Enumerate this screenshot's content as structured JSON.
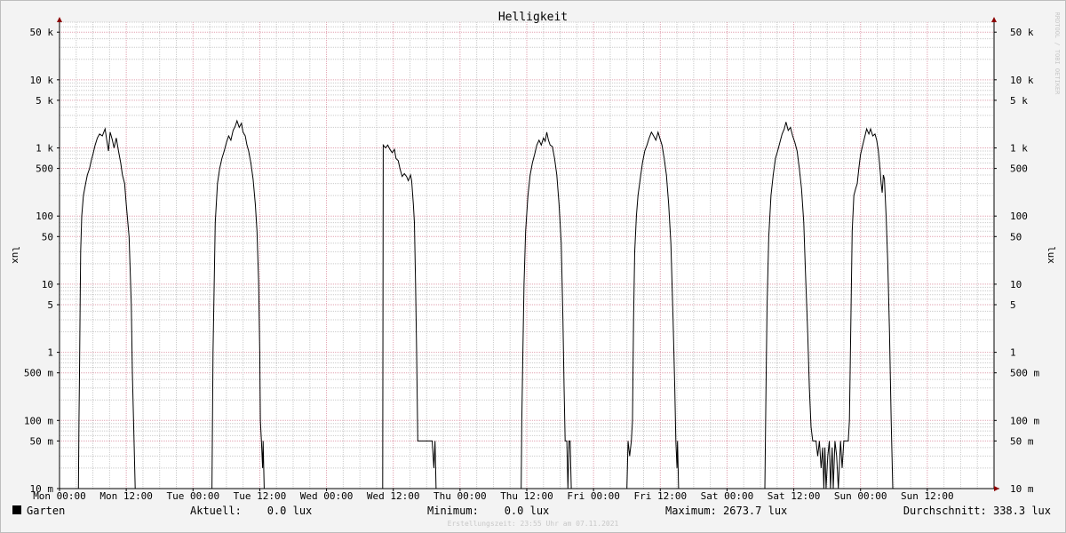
{
  "chart_data": {
    "type": "line",
    "title": "Helligkeit",
    "ylabel": "lux",
    "ylabel_right": "lux",
    "y_scale": "log",
    "ylim": [
      0.01,
      70000
    ],
    "y_ticks": [
      {
        "value": 0.01,
        "label": "10 m"
      },
      {
        "value": 0.05,
        "label": "50 m"
      },
      {
        "value": 0.1,
        "label": "100 m"
      },
      {
        "value": 0.5,
        "label": "500 m"
      },
      {
        "value": 1,
        "label": "1"
      },
      {
        "value": 5,
        "label": "5"
      },
      {
        "value": 10,
        "label": "10"
      },
      {
        "value": 50,
        "label": "50"
      },
      {
        "value": 100,
        "label": "100"
      },
      {
        "value": 500,
        "label": "500"
      },
      {
        "value": 1000,
        "label": "1 k"
      },
      {
        "value": 5000,
        "label": "5 k"
      },
      {
        "value": 10000,
        "label": "10 k"
      },
      {
        "value": 50000,
        "label": "50 k"
      }
    ],
    "x_unit": "hours",
    "xlim": [
      0,
      168
    ],
    "x_ticks": [
      {
        "value": 0,
        "label": "Mon 00:00"
      },
      {
        "value": 12,
        "label": "Mon 12:00"
      },
      {
        "value": 24,
        "label": "Tue 00:00"
      },
      {
        "value": 36,
        "label": "Tue 12:00"
      },
      {
        "value": 48,
        "label": "Wed 00:00"
      },
      {
        "value": 60,
        "label": "Wed 12:00"
      },
      {
        "value": 72,
        "label": "Thu 00:00"
      },
      {
        "value": 84,
        "label": "Thu 12:00"
      },
      {
        "value": 96,
        "label": "Fri 00:00"
      },
      {
        "value": 108,
        "label": "Fri 12:00"
      },
      {
        "value": 120,
        "label": "Sat 00:00"
      },
      {
        "value": 132,
        "label": "Sat 12:00"
      },
      {
        "value": 144,
        "label": "Sun 00:00"
      },
      {
        "value": 156,
        "label": "Sun 12:00"
      }
    ],
    "grid": true,
    "series": [
      {
        "name": "Garten",
        "color": "#000000",
        "points": [
          [
            0,
            0.01
          ],
          [
            3.4,
            0.01
          ],
          [
            3.5,
            0.1
          ],
          [
            3.6,
            0.5
          ],
          [
            3.7,
            5
          ],
          [
            3.8,
            30
          ],
          [
            4.0,
            100
          ],
          [
            4.3,
            200
          ],
          [
            4.7,
            300
          ],
          [
            5.0,
            400
          ],
          [
            5.4,
            500
          ],
          [
            5.7,
            650
          ],
          [
            6.0,
            800
          ],
          [
            6.4,
            1100
          ],
          [
            6.8,
            1400
          ],
          [
            7.2,
            1600
          ],
          [
            7.7,
            1500
          ],
          [
            8.2,
            1900
          ],
          [
            8.5,
            1300
          ],
          [
            8.8,
            900
          ],
          [
            9.1,
            1700
          ],
          [
            9.5,
            1300
          ],
          [
            9.8,
            1000
          ],
          [
            10.2,
            1400
          ],
          [
            10.6,
            900
          ],
          [
            11.0,
            600
          ],
          [
            11.3,
            400
          ],
          [
            11.7,
            300
          ],
          [
            12.0,
            150
          ],
          [
            12.5,
            50
          ],
          [
            12.9,
            5
          ],
          [
            13.1,
            0.5
          ],
          [
            13.4,
            0.05
          ],
          [
            13.6,
            0.01
          ],
          [
            15,
            0.01
          ],
          [
            15.5,
            0.01
          ],
          [
            27.4,
            0.01
          ],
          [
            27.5,
            0.1
          ],
          [
            27.6,
            1
          ],
          [
            27.8,
            10
          ],
          [
            28.0,
            80
          ],
          [
            28.4,
            300
          ],
          [
            28.8,
            500
          ],
          [
            29.2,
            700
          ],
          [
            29.6,
            900
          ],
          [
            30.0,
            1200
          ],
          [
            30.4,
            1500
          ],
          [
            30.8,
            1300
          ],
          [
            31.2,
            1800
          ],
          [
            31.6,
            2100
          ],
          [
            31.9,
            2500
          ],
          [
            32.3,
            2000
          ],
          [
            32.7,
            2300
          ],
          [
            33.0,
            1700
          ],
          [
            33.4,
            1500
          ],
          [
            33.7,
            1100
          ],
          [
            34.0,
            900
          ],
          [
            34.4,
            600
          ],
          [
            34.8,
            350
          ],
          [
            35.2,
            150
          ],
          [
            35.5,
            60
          ],
          [
            35.8,
            10
          ],
          [
            36.0,
            1
          ],
          [
            36.1,
            0.1
          ],
          [
            36.3,
            0.05
          ],
          [
            36.5,
            0.02
          ],
          [
            36.6,
            0.05
          ],
          [
            36.8,
            0.01
          ],
          [
            37.5,
            0.01
          ],
          [
            58.1,
            0.01
          ],
          [
            58.2,
            1100
          ],
          [
            58.6,
            1000
          ],
          [
            59.0,
            1100
          ],
          [
            59.4,
            950
          ],
          [
            59.8,
            850
          ],
          [
            60.2,
            950
          ],
          [
            60.5,
            700
          ],
          [
            60.9,
            650
          ],
          [
            61.2,
            500
          ],
          [
            61.6,
            380
          ],
          [
            62.0,
            420
          ],
          [
            62.4,
            380
          ],
          [
            62.7,
            330
          ],
          [
            63.1,
            400
          ],
          [
            63.3,
            330
          ],
          [
            63.6,
            150
          ],
          [
            63.8,
            80
          ],
          [
            64.0,
            10
          ],
          [
            64.2,
            1
          ],
          [
            64.4,
            0.05
          ],
          [
            67.0,
            0.05
          ],
          [
            67.3,
            0.02
          ],
          [
            67.5,
            0.05
          ],
          [
            67.7,
            0.01
          ],
          [
            68.5,
            0.01
          ],
          [
            83.0,
            0.01
          ],
          [
            83.1,
            0.1
          ],
          [
            83.3,
            1
          ],
          [
            83.5,
            10
          ],
          [
            83.8,
            60
          ],
          [
            84.2,
            200
          ],
          [
            84.6,
            400
          ],
          [
            85.0,
            600
          ],
          [
            85.4,
            800
          ],
          [
            85.8,
            1100
          ],
          [
            86.2,
            1300
          ],
          [
            86.6,
            1100
          ],
          [
            87.0,
            1400
          ],
          [
            87.3,
            1250
          ],
          [
            87.6,
            1700
          ],
          [
            87.9,
            1300
          ],
          [
            88.2,
            1100
          ],
          [
            88.6,
            1050
          ],
          [
            89.0,
            700
          ],
          [
            89.4,
            400
          ],
          [
            89.8,
            150
          ],
          [
            90.2,
            40
          ],
          [
            90.5,
            3
          ],
          [
            90.7,
            0.3
          ],
          [
            90.9,
            0.05
          ],
          [
            91.2,
            0.05
          ],
          [
            91.4,
            0.01
          ],
          [
            91.6,
            0.05
          ],
          [
            91.8,
            0.05
          ],
          [
            92.0,
            0.01
          ],
          [
            102.0,
            0.01
          ],
          [
            102.2,
            0.05
          ],
          [
            102.5,
            0.03
          ],
          [
            102.8,
            0.05
          ],
          [
            103.0,
            0.1
          ],
          [
            103.2,
            3
          ],
          [
            103.4,
            30
          ],
          [
            103.7,
            100
          ],
          [
            104.0,
            200
          ],
          [
            104.4,
            350
          ],
          [
            104.8,
            600
          ],
          [
            105.2,
            900
          ],
          [
            105.6,
            1100
          ],
          [
            106.0,
            1400
          ],
          [
            106.4,
            1700
          ],
          [
            106.8,
            1500
          ],
          [
            107.2,
            1300
          ],
          [
            107.6,
            1700
          ],
          [
            107.9,
            1400
          ],
          [
            108.3,
            1100
          ],
          [
            108.7,
            700
          ],
          [
            109.1,
            400
          ],
          [
            109.5,
            150
          ],
          [
            109.9,
            40
          ],
          [
            110.3,
            3
          ],
          [
            110.6,
            0.3
          ],
          [
            110.8,
            0.05
          ],
          [
            111.0,
            0.02
          ],
          [
            111.1,
            0.05
          ],
          [
            111.3,
            0.01
          ],
          [
            121.5,
            0.01
          ],
          [
            126.8,
            0.01
          ],
          [
            127.0,
            0.3
          ],
          [
            127.2,
            5
          ],
          [
            127.5,
            50
          ],
          [
            127.9,
            200
          ],
          [
            128.3,
            400
          ],
          [
            128.7,
            700
          ],
          [
            129.1,
            900
          ],
          [
            129.5,
            1200
          ],
          [
            129.9,
            1600
          ],
          [
            130.3,
            1900
          ],
          [
            130.6,
            2400
          ],
          [
            131.0,
            1800
          ],
          [
            131.4,
            2000
          ],
          [
            131.8,
            1500
          ],
          [
            132.2,
            1200
          ],
          [
            132.6,
            900
          ],
          [
            133.0,
            500
          ],
          [
            133.4,
            250
          ],
          [
            133.8,
            80
          ],
          [
            134.1,
            15
          ],
          [
            134.5,
            2
          ],
          [
            134.8,
            0.3
          ],
          [
            135.1,
            0.08
          ],
          [
            135.4,
            0.05
          ],
          [
            136.0,
            0.05
          ],
          [
            136.3,
            0.03
          ],
          [
            136.6,
            0.05
          ],
          [
            136.9,
            0.02
          ],
          [
            137.2,
            0.04
          ],
          [
            137.4,
            0.01
          ],
          [
            137.6,
            0.04
          ],
          [
            137.8,
            0.01
          ],
          [
            138.1,
            0.03
          ],
          [
            138.4,
            0.05
          ],
          [
            138.6,
            0.01
          ],
          [
            138.9,
            0.04
          ],
          [
            139.1,
            0.01
          ],
          [
            139.4,
            0.05
          ],
          [
            139.7,
            0.03
          ],
          [
            140.0,
            0.01
          ],
          [
            140.4,
            0.05
          ],
          [
            140.7,
            0.02
          ],
          [
            141.0,
            0.05
          ],
          [
            141.5,
            0.05
          ],
          [
            141.8,
            0.05
          ],
          [
            142.0,
            0.1
          ],
          [
            142.3,
            5
          ],
          [
            142.5,
            60
          ],
          [
            142.8,
            200
          ],
          [
            143.1,
            250
          ],
          [
            143.4,
            300
          ],
          [
            143.7,
            500
          ],
          [
            144.0,
            800
          ],
          [
            144.4,
            1100
          ],
          [
            144.8,
            1500
          ],
          [
            145.1,
            1900
          ],
          [
            145.5,
            1600
          ],
          [
            145.8,
            1900
          ],
          [
            146.2,
            1500
          ],
          [
            146.6,
            1600
          ],
          [
            146.9,
            1300
          ],
          [
            147.2,
            900
          ],
          [
            147.5,
            500
          ],
          [
            147.7,
            300
          ],
          [
            147.9,
            220
          ],
          [
            148.1,
            400
          ],
          [
            148.3,
            350
          ],
          [
            148.6,
            100
          ],
          [
            148.9,
            20
          ],
          [
            149.2,
            2
          ],
          [
            149.5,
            0.1
          ],
          [
            149.8,
            0.01
          ],
          [
            152.0,
            0.01
          ]
        ]
      }
    ]
  },
  "watermark": "RRDTOOL / TOBI OETIKER",
  "legend": {
    "label": "Garten",
    "color": "#000000"
  },
  "stats": {
    "current": "Aktuell:    0.0 lux",
    "minimum": "Minimum:    0.0 lux",
    "maximum": "Maximum: 2673.7 lux",
    "average": "Durchschnitt: 338.3 lux"
  },
  "footer_note": "Erstellungszeit: 23:55 Uhr am 07.11.2021"
}
